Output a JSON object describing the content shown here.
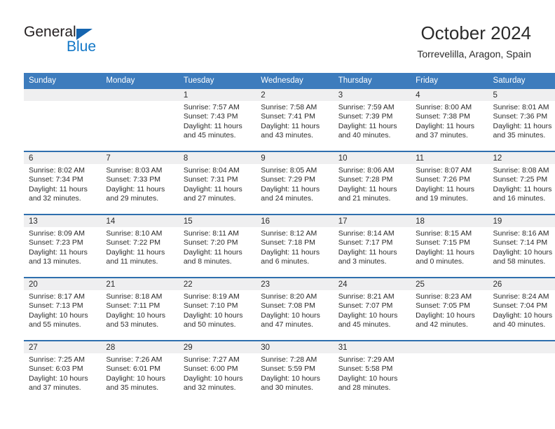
{
  "brand": {
    "name_top": "General",
    "name_bottom": "Blue",
    "triangle_icon": "triangle-icon",
    "accent_color": "#1277c7"
  },
  "header": {
    "title": "October 2024",
    "subtitle": "Torrevelilla, Aragon, Spain"
  },
  "theme": {
    "header_bg": "#3d7cbd",
    "header_text": "#ffffff",
    "row_divider": "#2f6fae",
    "daynum_band": "#efeff0",
    "body_text": "#2b2b2b"
  },
  "labels": {
    "sunrise_prefix": "Sunrise:",
    "sunset_prefix": "Sunset:",
    "daylight_prefix": "Daylight:"
  },
  "weekdays": [
    "Sunday",
    "Monday",
    "Tuesday",
    "Wednesday",
    "Thursday",
    "Friday",
    "Saturday"
  ],
  "weeks": [
    [
      {
        "day": "",
        "sunrise": "",
        "sunset": "",
        "daylight1": "",
        "daylight2": ""
      },
      {
        "day": "",
        "sunrise": "",
        "sunset": "",
        "daylight1": "",
        "daylight2": ""
      },
      {
        "day": "1",
        "sunrise": "Sunrise: 7:57 AM",
        "sunset": "Sunset: 7:43 PM",
        "daylight1": "Daylight: 11 hours",
        "daylight2": "and 45 minutes."
      },
      {
        "day": "2",
        "sunrise": "Sunrise: 7:58 AM",
        "sunset": "Sunset: 7:41 PM",
        "daylight1": "Daylight: 11 hours",
        "daylight2": "and 43 minutes."
      },
      {
        "day": "3",
        "sunrise": "Sunrise: 7:59 AM",
        "sunset": "Sunset: 7:39 PM",
        "daylight1": "Daylight: 11 hours",
        "daylight2": "and 40 minutes."
      },
      {
        "day": "4",
        "sunrise": "Sunrise: 8:00 AM",
        "sunset": "Sunset: 7:38 PM",
        "daylight1": "Daylight: 11 hours",
        "daylight2": "and 37 minutes."
      },
      {
        "day": "5",
        "sunrise": "Sunrise: 8:01 AM",
        "sunset": "Sunset: 7:36 PM",
        "daylight1": "Daylight: 11 hours",
        "daylight2": "and 35 minutes."
      }
    ],
    [
      {
        "day": "6",
        "sunrise": "Sunrise: 8:02 AM",
        "sunset": "Sunset: 7:34 PM",
        "daylight1": "Daylight: 11 hours",
        "daylight2": "and 32 minutes."
      },
      {
        "day": "7",
        "sunrise": "Sunrise: 8:03 AM",
        "sunset": "Sunset: 7:33 PM",
        "daylight1": "Daylight: 11 hours",
        "daylight2": "and 29 minutes."
      },
      {
        "day": "8",
        "sunrise": "Sunrise: 8:04 AM",
        "sunset": "Sunset: 7:31 PM",
        "daylight1": "Daylight: 11 hours",
        "daylight2": "and 27 minutes."
      },
      {
        "day": "9",
        "sunrise": "Sunrise: 8:05 AM",
        "sunset": "Sunset: 7:29 PM",
        "daylight1": "Daylight: 11 hours",
        "daylight2": "and 24 minutes."
      },
      {
        "day": "10",
        "sunrise": "Sunrise: 8:06 AM",
        "sunset": "Sunset: 7:28 PM",
        "daylight1": "Daylight: 11 hours",
        "daylight2": "and 21 minutes."
      },
      {
        "day": "11",
        "sunrise": "Sunrise: 8:07 AM",
        "sunset": "Sunset: 7:26 PM",
        "daylight1": "Daylight: 11 hours",
        "daylight2": "and 19 minutes."
      },
      {
        "day": "12",
        "sunrise": "Sunrise: 8:08 AM",
        "sunset": "Sunset: 7:25 PM",
        "daylight1": "Daylight: 11 hours",
        "daylight2": "and 16 minutes."
      }
    ],
    [
      {
        "day": "13",
        "sunrise": "Sunrise: 8:09 AM",
        "sunset": "Sunset: 7:23 PM",
        "daylight1": "Daylight: 11 hours",
        "daylight2": "and 13 minutes."
      },
      {
        "day": "14",
        "sunrise": "Sunrise: 8:10 AM",
        "sunset": "Sunset: 7:22 PM",
        "daylight1": "Daylight: 11 hours",
        "daylight2": "and 11 minutes."
      },
      {
        "day": "15",
        "sunrise": "Sunrise: 8:11 AM",
        "sunset": "Sunset: 7:20 PM",
        "daylight1": "Daylight: 11 hours",
        "daylight2": "and 8 minutes."
      },
      {
        "day": "16",
        "sunrise": "Sunrise: 8:12 AM",
        "sunset": "Sunset: 7:18 PM",
        "daylight1": "Daylight: 11 hours",
        "daylight2": "and 6 minutes."
      },
      {
        "day": "17",
        "sunrise": "Sunrise: 8:14 AM",
        "sunset": "Sunset: 7:17 PM",
        "daylight1": "Daylight: 11 hours",
        "daylight2": "and 3 minutes."
      },
      {
        "day": "18",
        "sunrise": "Sunrise: 8:15 AM",
        "sunset": "Sunset: 7:15 PM",
        "daylight1": "Daylight: 11 hours",
        "daylight2": "and 0 minutes."
      },
      {
        "day": "19",
        "sunrise": "Sunrise: 8:16 AM",
        "sunset": "Sunset: 7:14 PM",
        "daylight1": "Daylight: 10 hours",
        "daylight2": "and 58 minutes."
      }
    ],
    [
      {
        "day": "20",
        "sunrise": "Sunrise: 8:17 AM",
        "sunset": "Sunset: 7:13 PM",
        "daylight1": "Daylight: 10 hours",
        "daylight2": "and 55 minutes."
      },
      {
        "day": "21",
        "sunrise": "Sunrise: 8:18 AM",
        "sunset": "Sunset: 7:11 PM",
        "daylight1": "Daylight: 10 hours",
        "daylight2": "and 53 minutes."
      },
      {
        "day": "22",
        "sunrise": "Sunrise: 8:19 AM",
        "sunset": "Sunset: 7:10 PM",
        "daylight1": "Daylight: 10 hours",
        "daylight2": "and 50 minutes."
      },
      {
        "day": "23",
        "sunrise": "Sunrise: 8:20 AM",
        "sunset": "Sunset: 7:08 PM",
        "daylight1": "Daylight: 10 hours",
        "daylight2": "and 47 minutes."
      },
      {
        "day": "24",
        "sunrise": "Sunrise: 8:21 AM",
        "sunset": "Sunset: 7:07 PM",
        "daylight1": "Daylight: 10 hours",
        "daylight2": "and 45 minutes."
      },
      {
        "day": "25",
        "sunrise": "Sunrise: 8:23 AM",
        "sunset": "Sunset: 7:05 PM",
        "daylight1": "Daylight: 10 hours",
        "daylight2": "and 42 minutes."
      },
      {
        "day": "26",
        "sunrise": "Sunrise: 8:24 AM",
        "sunset": "Sunset: 7:04 PM",
        "daylight1": "Daylight: 10 hours",
        "daylight2": "and 40 minutes."
      }
    ],
    [
      {
        "day": "27",
        "sunrise": "Sunrise: 7:25 AM",
        "sunset": "Sunset: 6:03 PM",
        "daylight1": "Daylight: 10 hours",
        "daylight2": "and 37 minutes."
      },
      {
        "day": "28",
        "sunrise": "Sunrise: 7:26 AM",
        "sunset": "Sunset: 6:01 PM",
        "daylight1": "Daylight: 10 hours",
        "daylight2": "and 35 minutes."
      },
      {
        "day": "29",
        "sunrise": "Sunrise: 7:27 AM",
        "sunset": "Sunset: 6:00 PM",
        "daylight1": "Daylight: 10 hours",
        "daylight2": "and 32 minutes."
      },
      {
        "day": "30",
        "sunrise": "Sunrise: 7:28 AM",
        "sunset": "Sunset: 5:59 PM",
        "daylight1": "Daylight: 10 hours",
        "daylight2": "and 30 minutes."
      },
      {
        "day": "31",
        "sunrise": "Sunrise: 7:29 AM",
        "sunset": "Sunset: 5:58 PM",
        "daylight1": "Daylight: 10 hours",
        "daylight2": "and 28 minutes."
      },
      {
        "day": "",
        "sunrise": "",
        "sunset": "",
        "daylight1": "",
        "daylight2": ""
      },
      {
        "day": "",
        "sunrise": "",
        "sunset": "",
        "daylight1": "",
        "daylight2": ""
      }
    ]
  ]
}
